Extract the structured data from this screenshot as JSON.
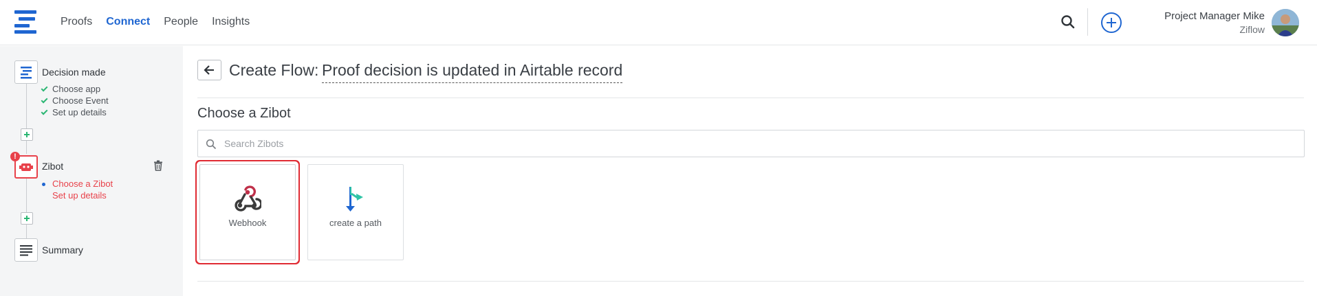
{
  "header": {
    "nav": [
      {
        "label": "Proofs",
        "active": false
      },
      {
        "label": "Connect",
        "active": true
      },
      {
        "label": "People",
        "active": false
      },
      {
        "label": "Insights",
        "active": false
      }
    ],
    "user": {
      "name": "Project Manager Mike",
      "org": "Ziflow"
    },
    "icons": {
      "search": "search-icon",
      "add": "plus-circle-icon",
      "logo": "ziflow-logo-icon"
    }
  },
  "sidebar": {
    "steps": [
      {
        "title": "Decision made",
        "icon": "ziflow-logo-icon",
        "subs": [
          "Choose app",
          "Choose Event",
          "Set up details"
        ],
        "status": "complete"
      },
      {
        "title": "Zibot",
        "icon": "robot-icon",
        "subs": [
          "Choose a Zibot",
          "Set up details"
        ],
        "status": "error"
      },
      {
        "title": "Summary",
        "icon": "list-icon",
        "subs": [],
        "status": "pending"
      }
    ]
  },
  "main": {
    "title_prefix": "Create Flow:",
    "flow_name": "Proof decision is updated in Airtable record",
    "section_title": "Choose a Zibot",
    "search_placeholder": "Search Zibots",
    "zibots": [
      {
        "label": "Webhook",
        "icon": "webhook-icon",
        "selected": true
      },
      {
        "label": "create a path",
        "icon": "path-icon",
        "selected": false
      }
    ]
  },
  "colors": {
    "brand_blue": "#1f66d1",
    "error_red": "#e8414a",
    "success_green": "#2bb673",
    "path_teal": "#2ec4a6"
  }
}
